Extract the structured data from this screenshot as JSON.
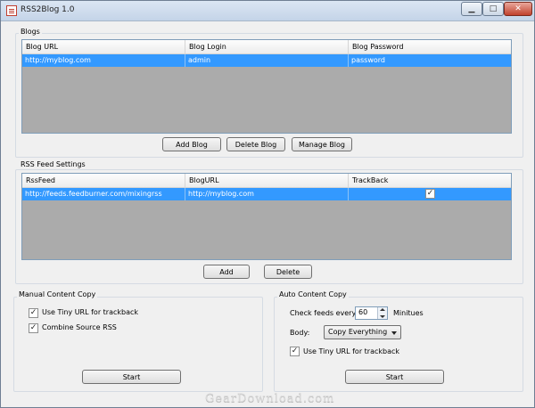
{
  "window": {
    "title": "RSS2Blog 1.0",
    "controls": {
      "minimize": "▁",
      "maximize": "□",
      "close": "✕"
    }
  },
  "blogs": {
    "group_label": "Blogs",
    "columns": [
      "Blog URL",
      "Blog Login",
      "Blog Password"
    ],
    "rows": [
      [
        "http://myblog.com",
        "admin",
        "password"
      ]
    ],
    "buttons": {
      "add": "Add Blog",
      "delete": "Delete Blog",
      "manage": "Manage Blog"
    }
  },
  "rss": {
    "group_label": "RSS Feed Settings",
    "columns": [
      "RssFeed",
      "BlogURL",
      "TrackBack"
    ],
    "rows": [
      [
        "http://feeds.feedburner.com/mixingrss",
        "http://myblog.com",
        "✓"
      ]
    ],
    "buttons": {
      "add": "Add",
      "delete": "Delete"
    }
  },
  "manual": {
    "group_label": "Manual Content Copy",
    "tiny_url_label": "Use Tiny URL for trackback",
    "tiny_url_checked": "✓",
    "combine_label": "Combine Source RSS",
    "combine_checked": "✓",
    "start": "Start"
  },
  "auto": {
    "group_label": "Auto Content Copy",
    "check_feeds_label": "Check feeds every:",
    "check_feeds_value": "60",
    "minutes_label": "Minitues",
    "body_label": "Body:",
    "body_value": "Copy Everything",
    "tiny_url_label": "Use Tiny URL for trackback",
    "tiny_url_checked": "✓",
    "start": "Start"
  },
  "watermark": "GearDownload.com",
  "colors": {
    "selection": "#3399ff",
    "grid_empty": "#ababab"
  }
}
